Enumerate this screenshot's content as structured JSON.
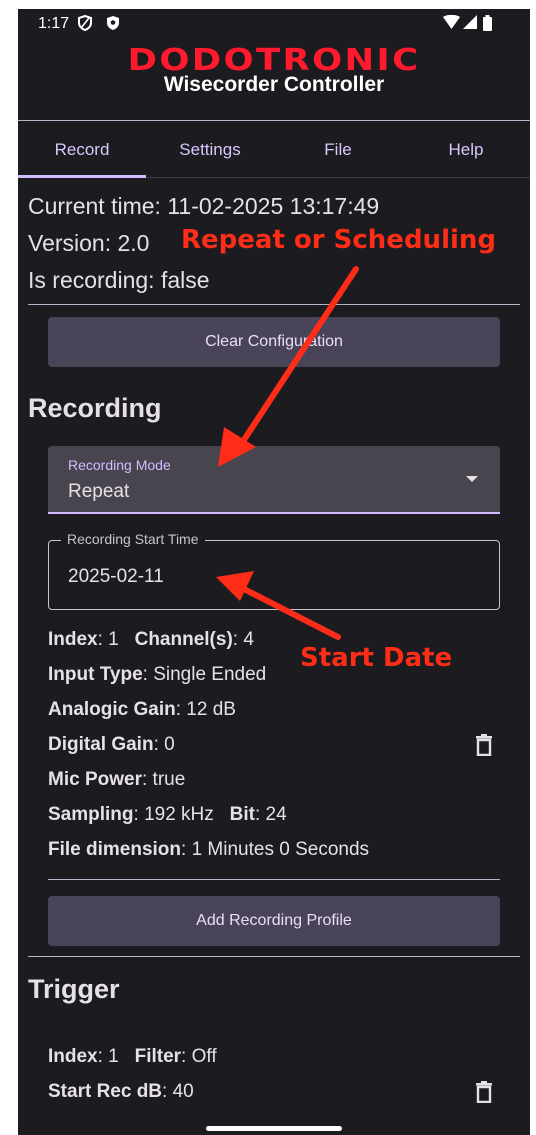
{
  "status_bar": {
    "time": "1:17"
  },
  "header": {
    "brand": "DODOTRONIC",
    "subtitle": "Wisecorder Controller"
  },
  "tabs": [
    {
      "label": "Record",
      "selected": true
    },
    {
      "label": "Settings",
      "selected": false
    },
    {
      "label": "File",
      "selected": false
    },
    {
      "label": "Help",
      "selected": false
    }
  ],
  "info": {
    "current_time": "Current time: 11-02-2025 13:17:49",
    "version": "Version: 2.0",
    "is_recording": "Is recording: false"
  },
  "buttons": {
    "clear_configuration": "Clear Configuration",
    "add_recording_profile": "Add Recording Profile"
  },
  "recording": {
    "title": "Recording",
    "mode_label": "Recording Mode",
    "mode_value": "Repeat",
    "start_time_label": "Recording Start Time",
    "start_time_value": "2025-02-11",
    "profile": {
      "index_label": "Index",
      "index_value": ": 1",
      "channels_label": "Channel(s)",
      "channels_value": ": 4",
      "input_type_label": "Input Type",
      "input_type_value": ": Single Ended",
      "analogic_gain_label": "Analogic Gain",
      "analogic_gain_value": ": 12 dB",
      "digital_gain_label": "Digital Gain",
      "digital_gain_value": ": 0",
      "mic_power_label": "Mic Power",
      "mic_power_value": ": true",
      "sampling_label": "Sampling",
      "sampling_value": ": 192 kHz",
      "bit_label": "Bit",
      "bit_value": ": 24",
      "file_dimension_label": "File dimension",
      "file_dimension_value": ": 1 Minutes 0 Seconds"
    }
  },
  "trigger": {
    "title": "Trigger",
    "index_label": "Index",
    "index_value": ": 1",
    "filter_label": "Filter",
    "filter_value": ": Off",
    "start_rec_label": "Start Rec dB",
    "start_rec_value": ": 40"
  },
  "annotations": {
    "repeat_or_scheduling": "Repeat or Scheduling",
    "start_date": "Start Date"
  },
  "colors": {
    "background": "#1c1b1f",
    "accent": "#d0bcff",
    "button": "#4a4458",
    "brand_red": "#ff1a2e",
    "annotation_red": "#ff2d17"
  }
}
